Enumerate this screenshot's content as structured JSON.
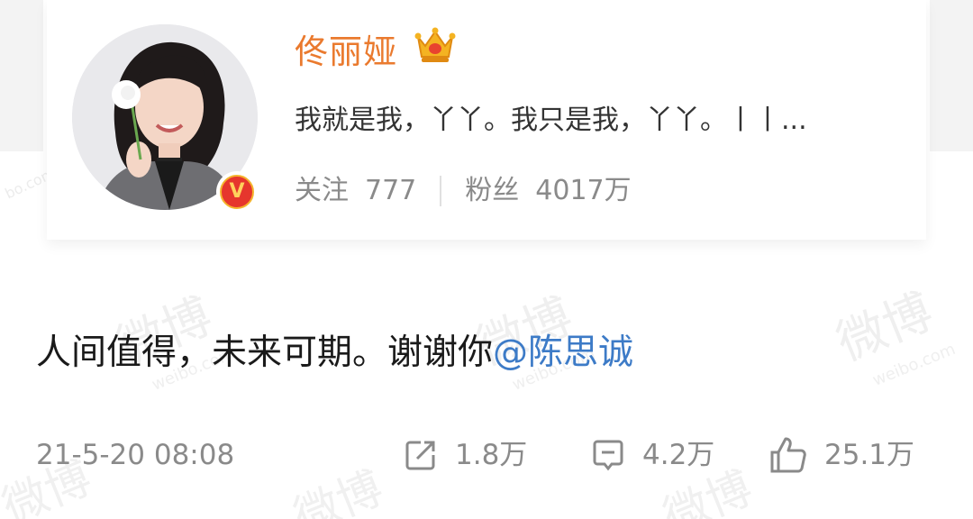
{
  "profile": {
    "name": "佟丽娅",
    "bio": "我就是我，丫丫。我只是我，丫丫。丨丨...",
    "follow_label": "关注",
    "follow_count": "777",
    "fans_label": "粉丝",
    "fans_count": "4017万",
    "verified_badge": "V"
  },
  "post": {
    "text": "人间值得，未来可期。谢谢你",
    "mention": "@陈思诚",
    "timestamp": "21-5-20 08:08"
  },
  "actions": {
    "repost_count": "1.8万",
    "comment_count": "4.2万",
    "like_count": "25.1万"
  },
  "icons": {
    "crown": "crown-icon",
    "repost": "repost-icon",
    "comment": "comment-icon",
    "like": "thumbs-up-icon",
    "verified": "verified-v-icon"
  },
  "colors": {
    "username": "#ea7a2e",
    "mention": "#3d7bc7",
    "muted": "#8a8a8a",
    "text": "#1a1a1a"
  }
}
